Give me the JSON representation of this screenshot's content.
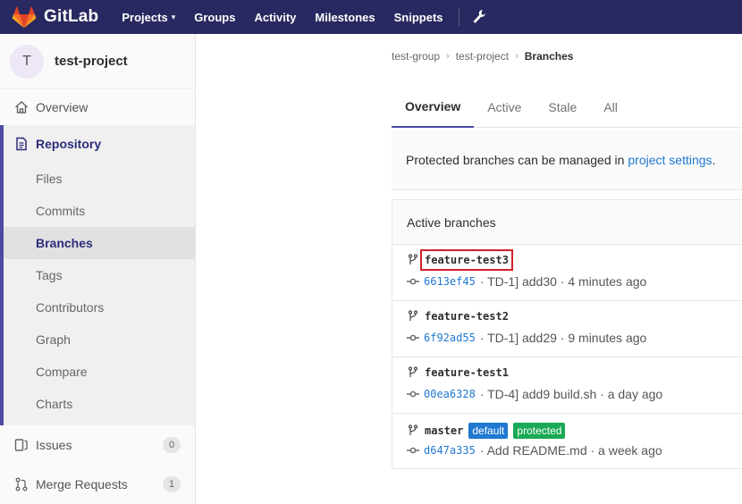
{
  "navbar": {
    "brand": "GitLab",
    "links": [
      "Projects",
      "Groups",
      "Activity",
      "Milestones",
      "Snippets"
    ],
    "projects_chevron": "▾",
    "colors": {
      "bg": "#292961"
    }
  },
  "sidebar": {
    "avatar_letter": "T",
    "project_name": "test-project",
    "overview": "Overview",
    "repository": "Repository",
    "repo_items": [
      "Files",
      "Commits",
      "Branches",
      "Tags",
      "Contributors",
      "Graph",
      "Compare",
      "Charts"
    ],
    "issues": {
      "label": "Issues",
      "count": "0"
    },
    "merge_requests": {
      "label": "Merge Requests",
      "count": "1"
    }
  },
  "breadcrumb": {
    "group": "test-group",
    "project": "test-project",
    "current": "Branches"
  },
  "tabs": [
    "Overview",
    "Active",
    "Stale",
    "All"
  ],
  "notice": {
    "text": "Protected branches can be managed in",
    "link": "project settings",
    "suffix": "."
  },
  "panel": {
    "title": "Active branches",
    "branches": [
      {
        "name": "feature-test3",
        "sha": "6613ef45",
        "message": "· TD-1] add30 · 4 minutes ago"
      },
      {
        "name": "feature-test2",
        "sha": "6f92ad55",
        "message": "· TD-1] add29 · 9 minutes ago"
      },
      {
        "name": "feature-test1",
        "sha": "00ea6328",
        "message": "· TD-4] add9 build.sh · a day ago"
      },
      {
        "name": "master",
        "sha": "d647a335",
        "message": "· Add README.md · a week ago",
        "badges": [
          "default",
          "protected"
        ]
      }
    ]
  }
}
